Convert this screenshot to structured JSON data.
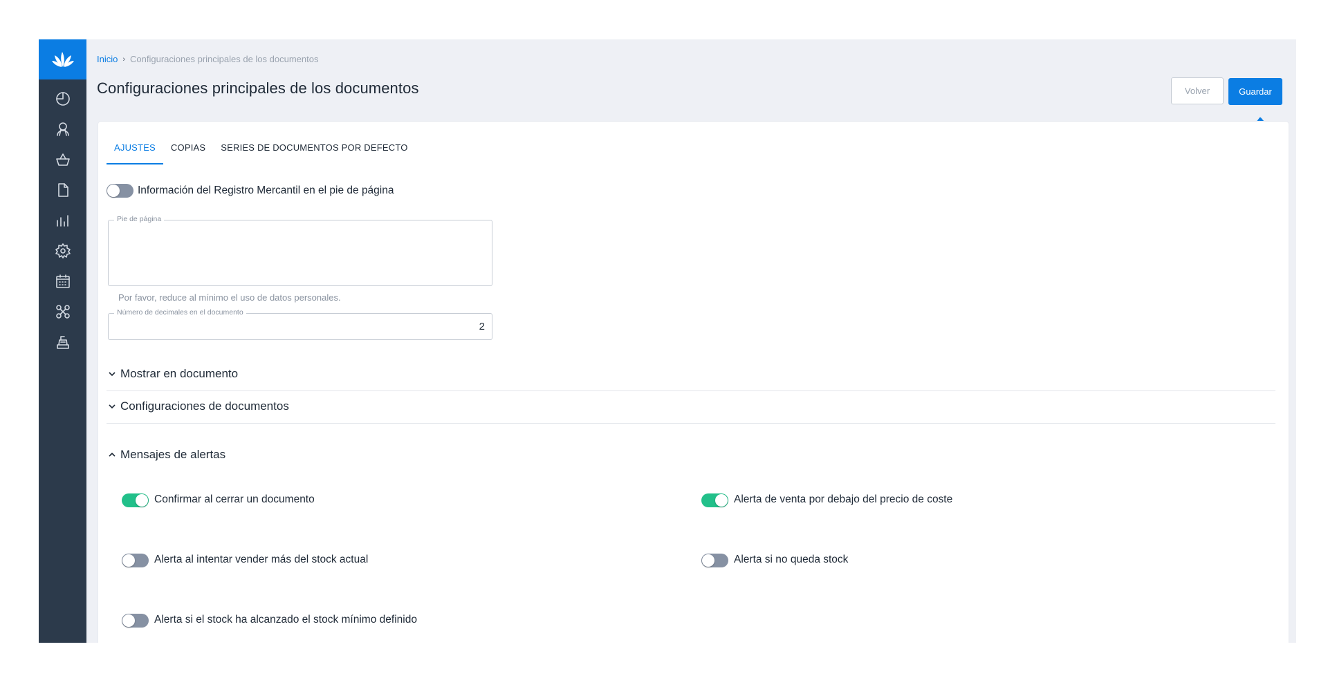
{
  "breadcrumb": {
    "home": "Inicio",
    "separator": "›",
    "current": "Configuraciones principales de los documentos"
  },
  "page": {
    "title": "Configuraciones principales de los documentos"
  },
  "actions": {
    "back_label": "Volver",
    "save_label": "Guardar"
  },
  "sidebar": {
    "icons": [
      "logo-icon",
      "dashboard-icon",
      "user-icon",
      "basket-icon",
      "document-icon",
      "reports-icon",
      "settings-icon",
      "calendar-icon",
      "integrations-icon",
      "cash-register-icon"
    ]
  },
  "tabs": [
    {
      "label": "AJUSTES",
      "active": true
    },
    {
      "label": "COPIAS",
      "active": false
    },
    {
      "label": "SERIES DE DOCUMENTOS POR DEFECTO",
      "active": false
    }
  ],
  "settings": {
    "registro_mercantil": {
      "label": "Información del Registro Mercantil en el pie de página",
      "on": false
    },
    "footer": {
      "legend": "Pie de página",
      "value": "",
      "helper": "Por favor, reduce al mínimo el uso de datos personales."
    },
    "decimals": {
      "legend": "Número de decimales en el documento",
      "value": "2"
    }
  },
  "sections": {
    "show_in_document": {
      "label": "Mostrar en documento",
      "expanded": false
    },
    "document_settings": {
      "label": "Configuraciones de documentos",
      "expanded": false
    },
    "alerts": {
      "label": "Mensajes de alertas",
      "expanded": true
    }
  },
  "alerts": {
    "confirm_close": {
      "label": "Confirmar al cerrar un documento",
      "on": true
    },
    "below_cost": {
      "label": "Alerta de venta por debajo del precio de coste",
      "on": true
    },
    "oversell": {
      "label": "Alerta al intentar vender más del stock actual",
      "on": false
    },
    "no_stock": {
      "label": "Alerta si no queda stock",
      "on": false
    },
    "min_stock": {
      "label": "Alerta si el stock ha alcanzado el stock mínimo definido",
      "on": false
    }
  },
  "colors": {
    "accent": "#0b7de3",
    "sidebar": "#2c3a4b",
    "toggle_on": "#22c08a",
    "toggle_off": "#8691a3",
    "background": "#eef0f5"
  }
}
